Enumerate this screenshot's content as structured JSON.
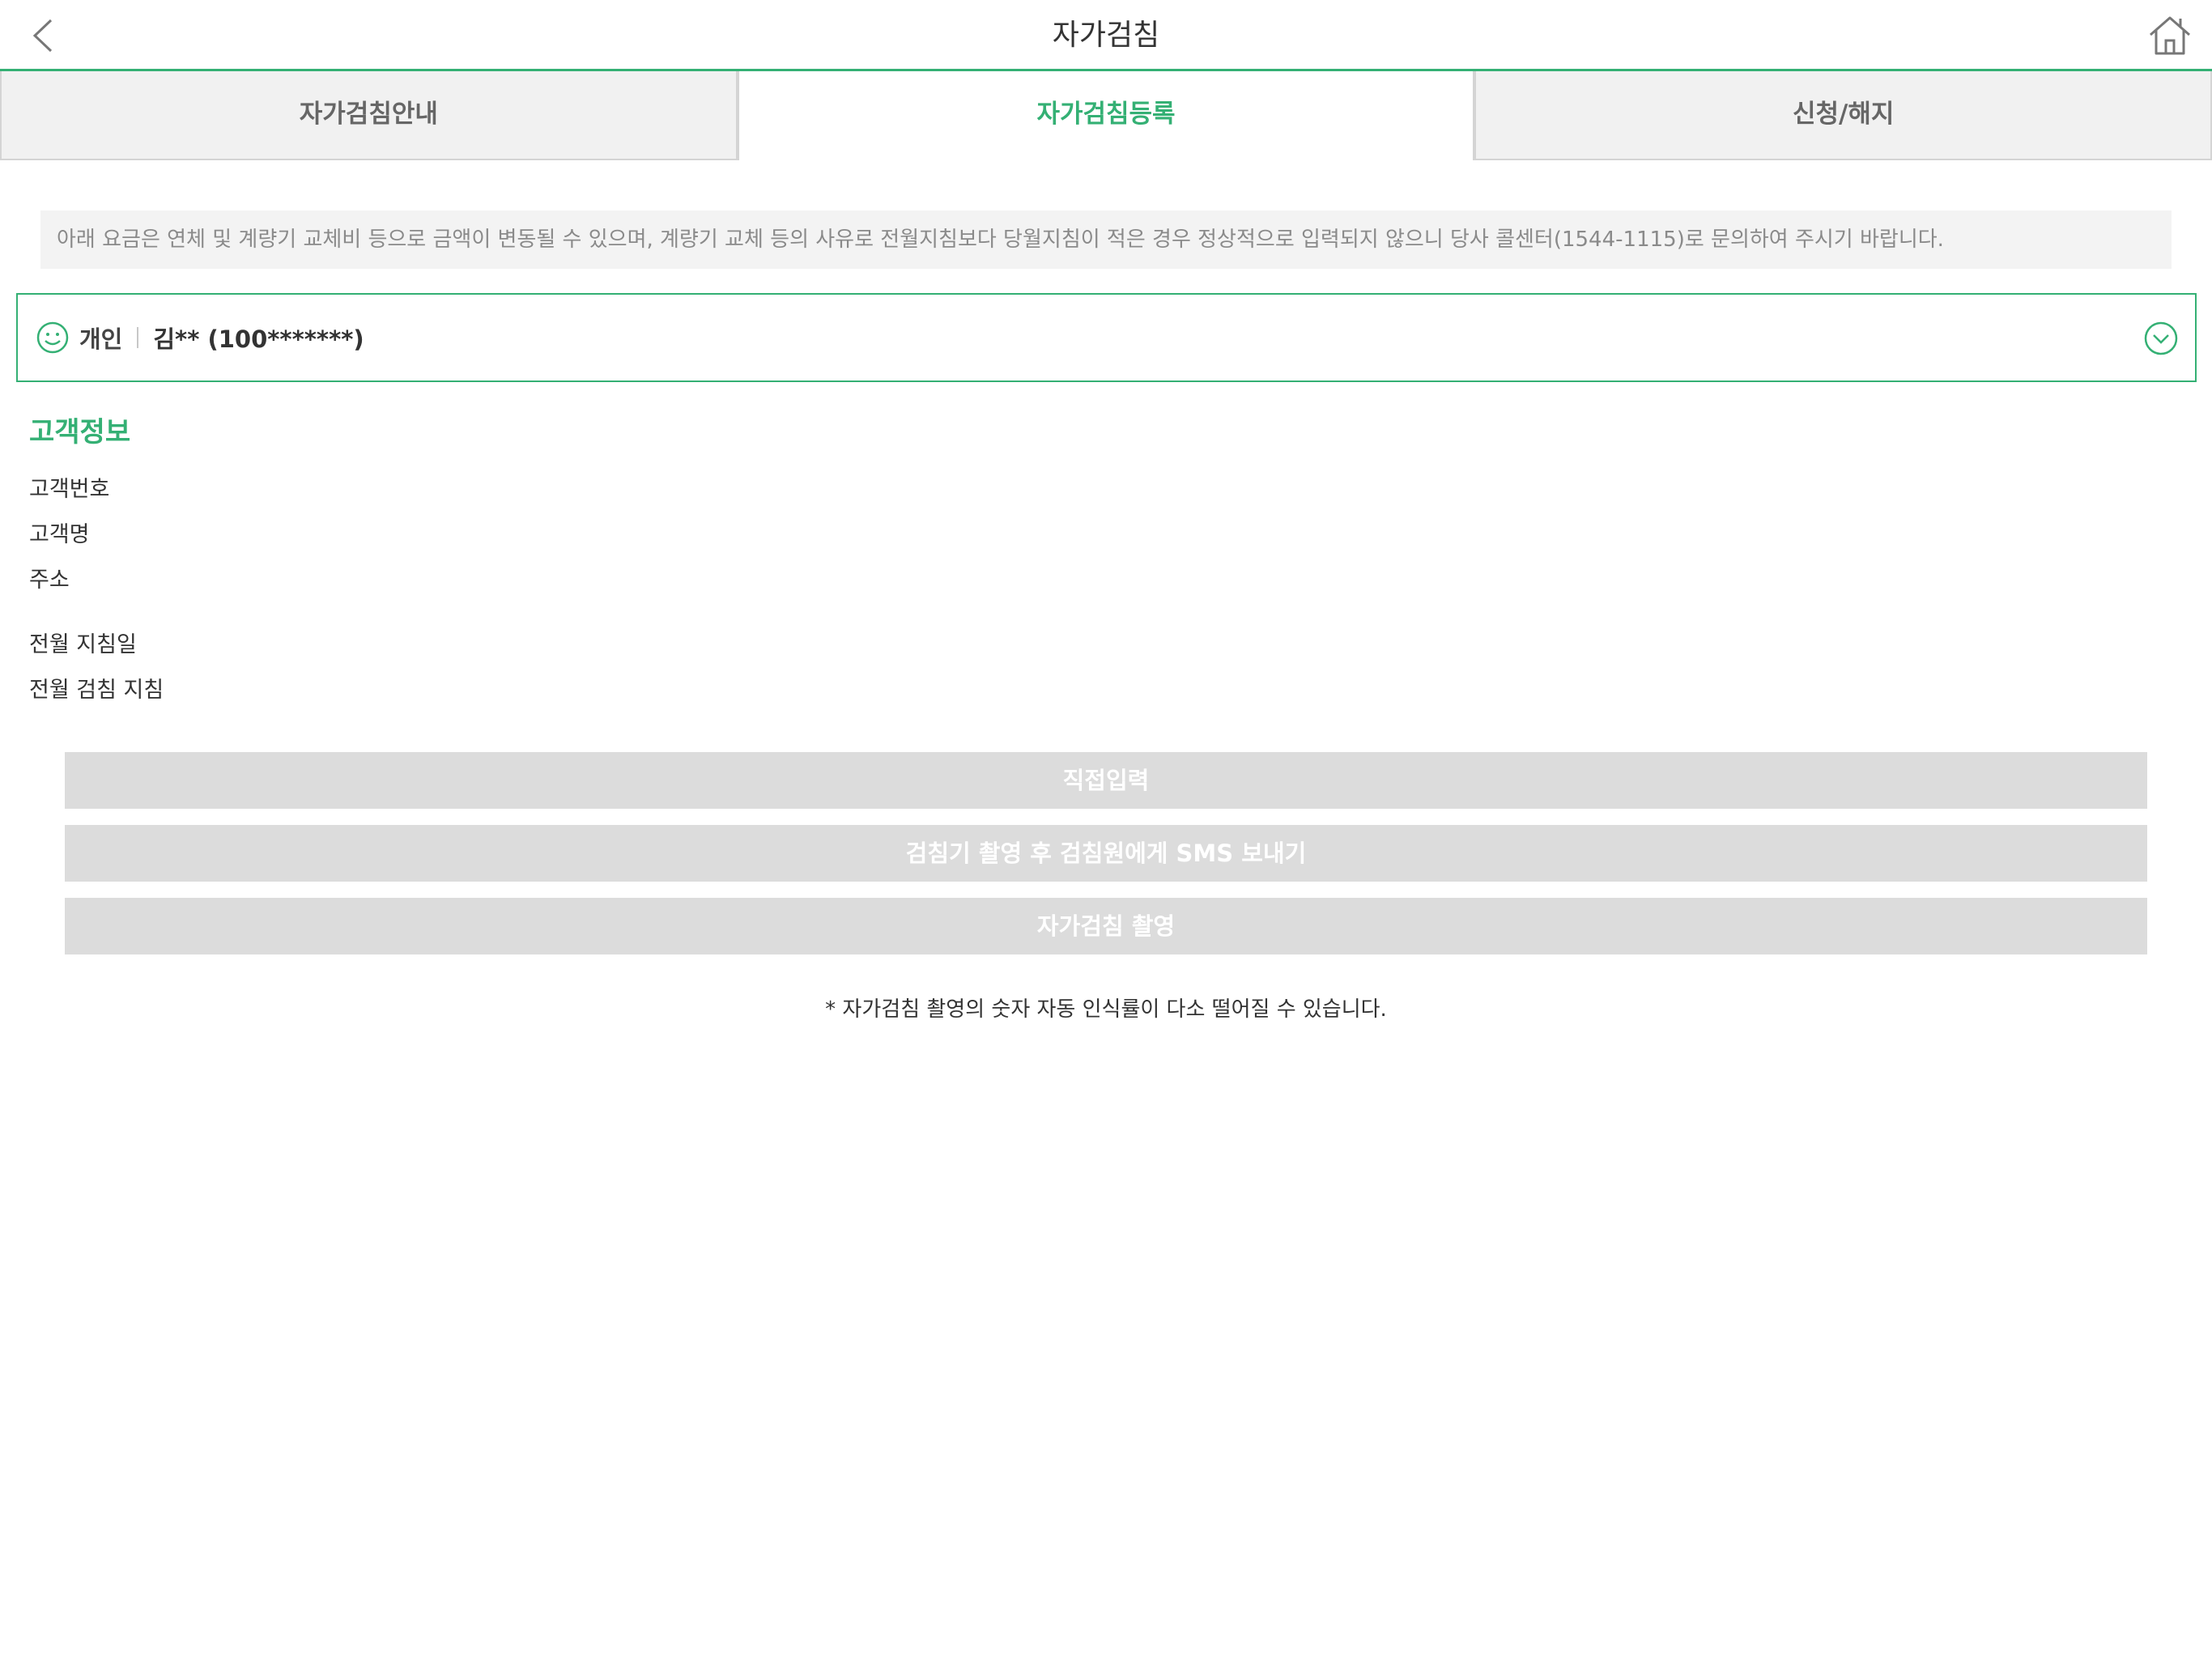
{
  "header": {
    "title": "자가검침",
    "back_icon": "chevron-left-icon",
    "home_icon": "home-icon"
  },
  "tabs": [
    {
      "label": "자가검침안내",
      "active": false
    },
    {
      "label": "자가검침등록",
      "active": true
    },
    {
      "label": "신청/해지",
      "active": false
    }
  ],
  "notice": "아래 요금은 연체 및 계량기 교체비 등으로 금액이 변동될 수 있으며, 계량기 교체 등의 사유로 전월지침보다 당월지침이 적은 경우 정상적으로 입력되지 않으니 당사 콜센터(1544-1115)로 문의하여 주시기 바랍니다.",
  "customer_select": {
    "type": "개인",
    "name": "김** (100*******)",
    "icon": "smile-icon",
    "dropdown_icon": "chevron-down-circle-icon"
  },
  "customer_info": {
    "title": "고객정보",
    "labels": {
      "number": "고객번호",
      "name": "고객명",
      "address": "주소",
      "prev_date": "전월 지침일",
      "prev_reading": "전월 검침 지침"
    }
  },
  "buttons": {
    "direct_input": "직접입력",
    "send_sms": "검침기 촬영 후 검침원에게 SMS 보내기",
    "capture": "자가검침 촬영"
  },
  "footnote": "* 자가검침 촬영의 숫자 자동 인식률이 다소 떨어질 수 있습니다.",
  "colors": {
    "accent": "#34b074",
    "disabled_button": "#dcdcdc",
    "tab_inactive_bg": "#f1f1f1",
    "notice_bg": "#f3f3f3"
  }
}
